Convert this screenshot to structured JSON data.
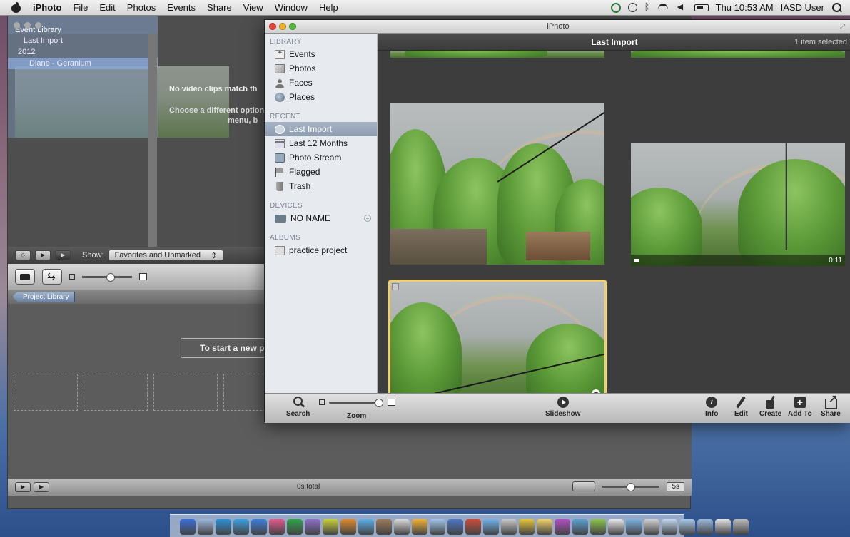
{
  "menubar": {
    "app_name": "iPhoto",
    "menus": [
      "File",
      "Edit",
      "Photos",
      "Events",
      "Share",
      "View",
      "Window",
      "Help"
    ],
    "clock": "Thu 10:53 AM",
    "user": "IASD User"
  },
  "imovie": {
    "event_library_title": "Event Library",
    "event_rows": [
      "Last Import",
      "2012",
      "Diane - Geranium"
    ],
    "no_clips_msg": "No video clips match th",
    "choose_msg": "Choose a different option",
    "choose_msg2": "menu, b",
    "show_label": "Show:",
    "show_value": "Favorites and Unmarked",
    "project_library": "Project Library",
    "start_new": "To start a new p",
    "total": "0s total",
    "duration": "5s"
  },
  "iphoto": {
    "window_title": "iPhoto",
    "header_title": "Last Import",
    "item_count": "1 item selected",
    "sidebar": {
      "library_head": "LIBRARY",
      "library": [
        "Events",
        "Photos",
        "Faces",
        "Places"
      ],
      "recent_head": "RECENT",
      "recent": [
        "Last Import",
        "Last 12 Months",
        "Photo Stream",
        "Flagged",
        "Trash"
      ],
      "devices_head": "DEVICES",
      "devices": [
        "NO NAME"
      ],
      "albums_head": "ALBUMS",
      "albums": [
        "practice project"
      ]
    },
    "video_duration": "0:11",
    "toolbar": {
      "search": "Search",
      "zoom": "Zoom",
      "slideshow": "Slideshow",
      "info": "Info",
      "edit": "Edit",
      "create": "Create",
      "add_to": "Add To",
      "share": "Share"
    }
  },
  "dock_colors": [
    "#3a6fd8",
    "#9bb7d9",
    "#2d8fd6",
    "#3aa0e0",
    "#3c7dd9",
    "#e25a8a",
    "#2fa34a",
    "#8b6fc8",
    "#c9cf3a",
    "#e08a2a",
    "#5ab0e8",
    "#9a7a5a",
    "#d9d9d9",
    "#f2b134",
    "#a0c4e8",
    "#4b77c4",
    "#c94c3a",
    "#6fb1e8",
    "#c8c8c8",
    "#e4c43a",
    "#f0d26a",
    "#b04fc2",
    "#5aa0d0",
    "#8bc34a",
    "#e8e8e8",
    "#7ab0e0",
    "#d0d0d0",
    "#c0d8f0",
    "#a8c8e8",
    "#9ab8d8",
    "#e0e0e0",
    "#bcbcbc"
  ]
}
